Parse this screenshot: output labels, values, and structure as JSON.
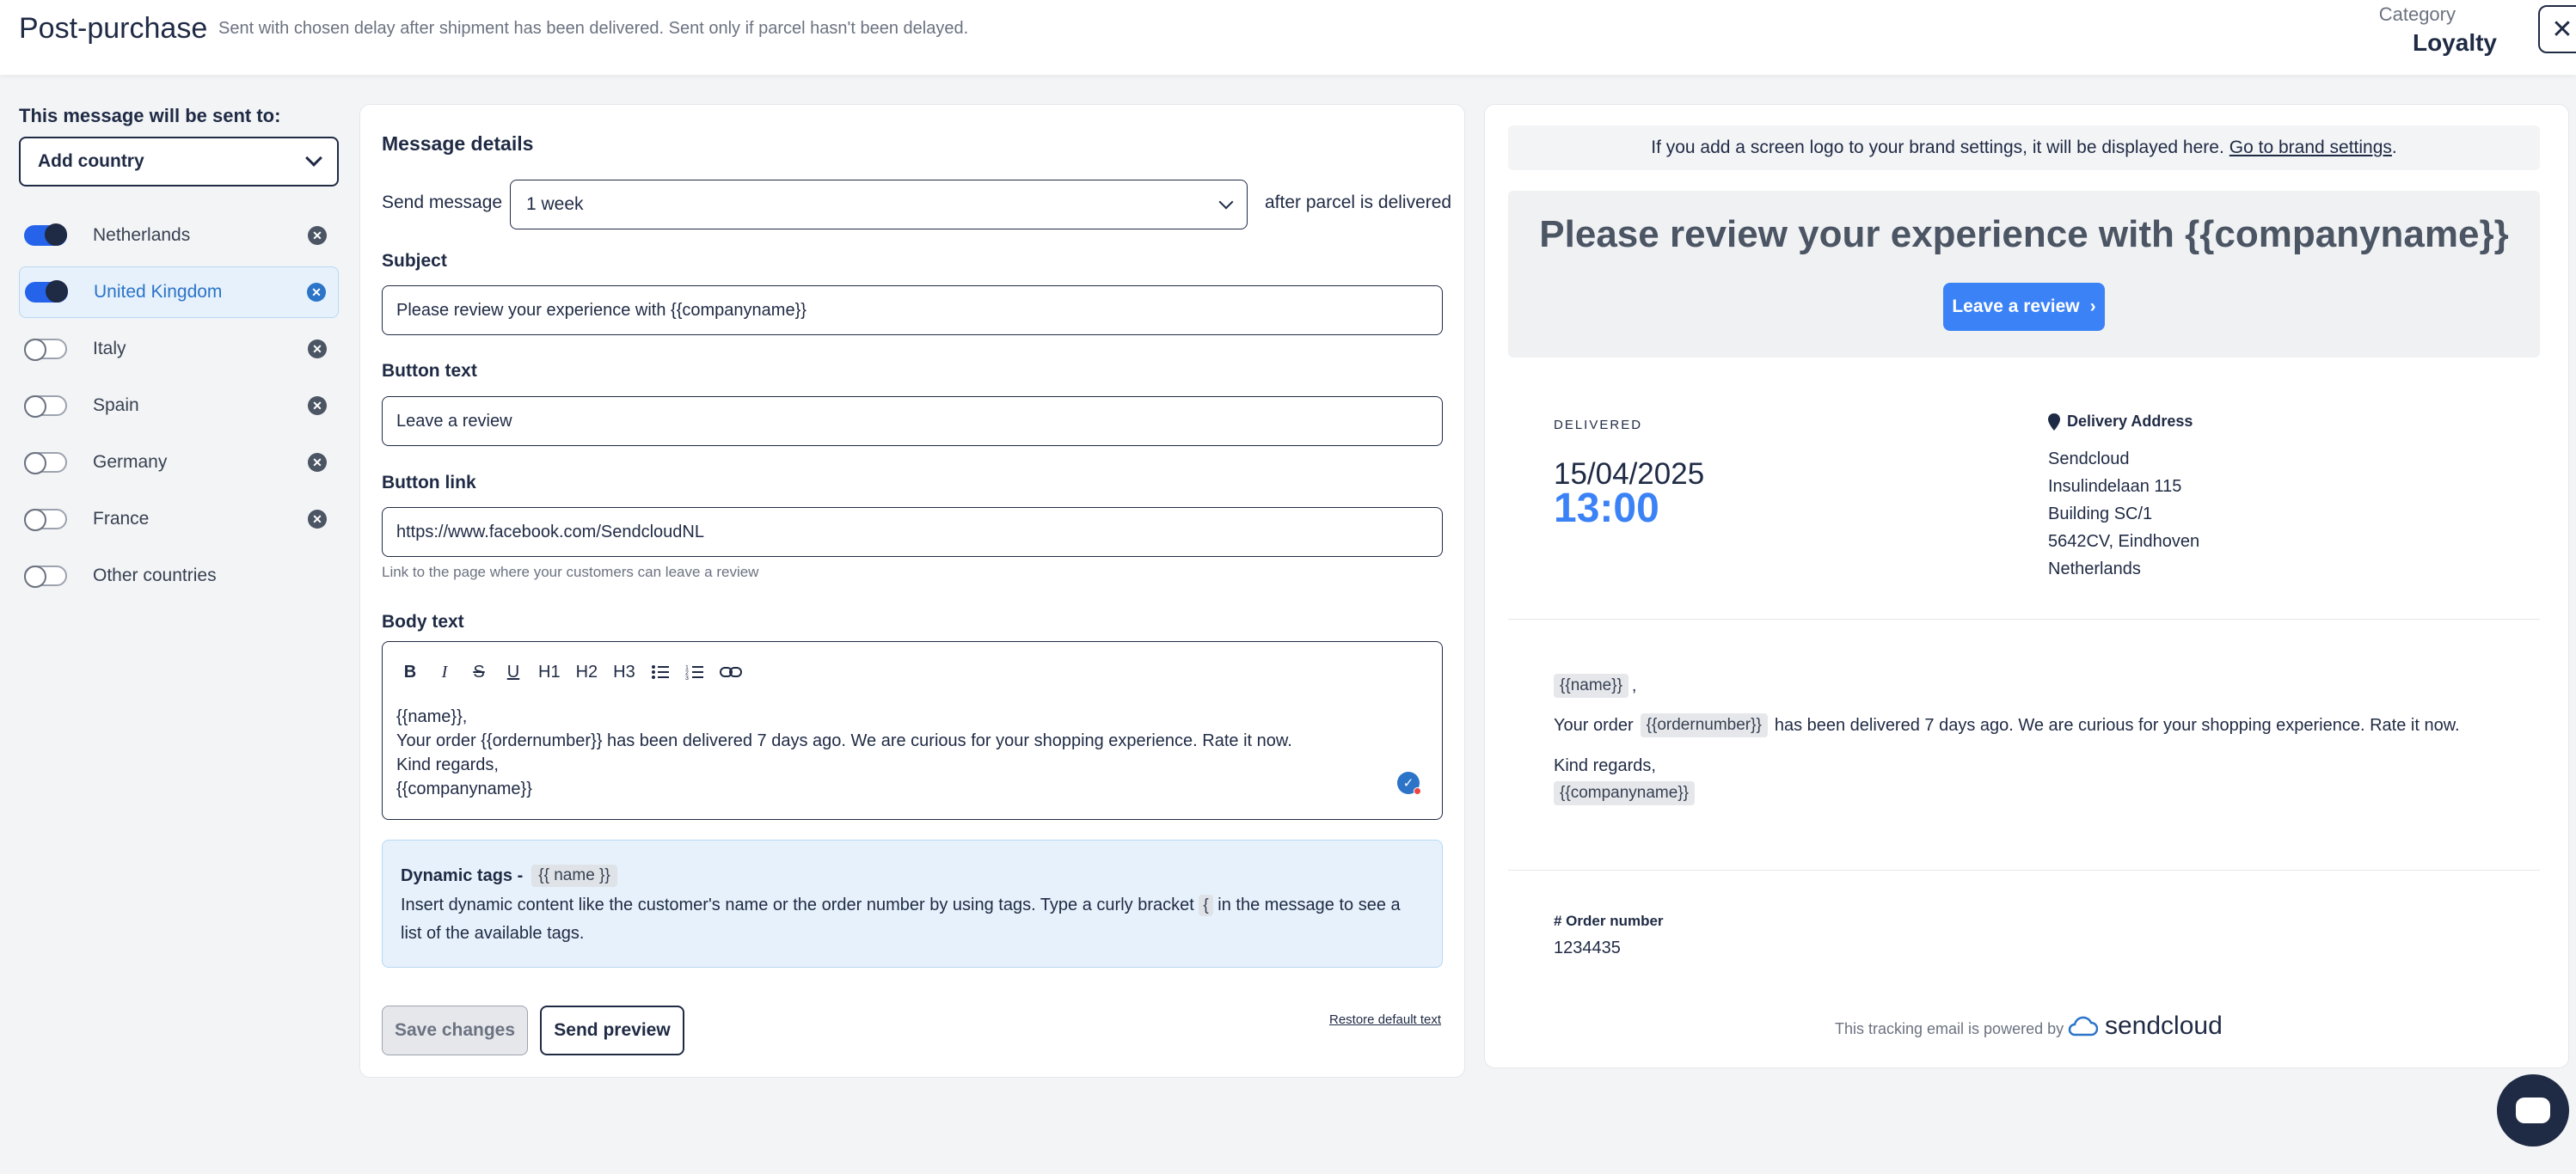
{
  "header": {
    "title": "Post-purchase",
    "subtitle": "Sent with chosen delay after shipment has been delivered. Sent only if parcel hasn't been delayed.",
    "category_label": "Category",
    "category_value": "Loyalty",
    "close_icon": "close-icon"
  },
  "countries": {
    "heading": "This message will be sent to:",
    "select_label": "Add country",
    "items": [
      {
        "label": "Netherlands",
        "enabled": true,
        "removable": true
      },
      {
        "label": "United Kingdom",
        "enabled": true,
        "removable": true,
        "selected": true
      },
      {
        "label": "Italy",
        "enabled": false,
        "removable": true
      },
      {
        "label": "Spain",
        "enabled": false,
        "removable": true
      },
      {
        "label": "Germany",
        "enabled": false,
        "removable": true
      },
      {
        "label": "France",
        "enabled": false,
        "removable": true
      },
      {
        "label": "Other countries",
        "enabled": false,
        "removable": false
      }
    ]
  },
  "details": {
    "title": "Message details",
    "send_label": "Send message",
    "period_value": "1 week",
    "after_label": "after parcel is delivered",
    "subject_label": "Subject",
    "subject_value": "Please review your experience with {{companyname}}",
    "button_text_label": "Button text",
    "button_text_value": "Leave a review",
    "button_link_label": "Button link",
    "button_link_value": "https://www.facebook.com/SendcloudNL",
    "button_link_hint": "Link to the page where your customers can leave a review",
    "body_label": "Body text",
    "toolbar": {
      "h1": "H1",
      "h2": "H2",
      "h3": "H3"
    },
    "body_value": "{{name}},\nYour order {{ordernumber}} has been delivered 7 days ago. We are curious for your shopping experience. Rate it now.\nKind regards,\n{{companyname}}",
    "dynamic_title": "Dynamic tags -",
    "dynamic_chip": "{{ name }}",
    "dynamic_text_a": "Insert dynamic content like the customer's name or the order number by using tags. Type a curly bracket",
    "dynamic_bracket": "{",
    "dynamic_text_b": "in the message to see a list of the available tags.",
    "save_label": "Save changes",
    "preview_label": "Send preview",
    "restore_label": "Restore default text"
  },
  "preview": {
    "logo_notice": "If you add a screen logo to your brand settings, it will be displayed here.",
    "logo_link": "Go to brand settings",
    "logo_period": ".",
    "hero_title": "Please review your experience with {{companyname}}",
    "hero_button": "Leave a review",
    "delivered_label": "DELIVERED",
    "date": "15/04/2025",
    "time": "13:00",
    "address_title": "Delivery Address",
    "address_lines": [
      "Sendcloud",
      "Insulindelaan 115",
      "Building SC/1",
      "5642CV, Eindhoven",
      "Netherlands"
    ],
    "msg_name_tag": "{{name}}",
    "msg_comma": ",",
    "msg_order_prefix": "Your order",
    "msg_order_tag": "{{ordernumber}}",
    "msg_order_suffix": "has been delivered 7 days ago. We are curious for your shopping experience. Rate it now.",
    "msg_regards": "Kind regards,",
    "msg_company_tag": "{{companyname}}",
    "order_label": "# Order number",
    "order_value": "1234435",
    "powered_by": "This tracking email is powered by",
    "brand_name": "sendcloud"
  },
  "colors": {
    "accent": "#3b82f6",
    "primary_dark": "#1f2a44",
    "selected_bg": "#e6f1fb"
  }
}
